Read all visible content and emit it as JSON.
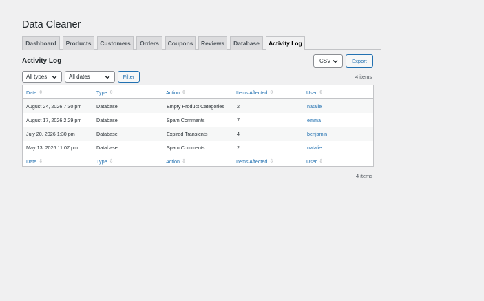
{
  "page": {
    "title": "Data Cleaner"
  },
  "tabs": [
    {
      "label": "Dashboard",
      "active": false
    },
    {
      "label": "Products",
      "active": false
    },
    {
      "label": "Customers",
      "active": false
    },
    {
      "label": "Orders",
      "active": false
    },
    {
      "label": "Coupons",
      "active": false
    },
    {
      "label": "Reviews",
      "active": false
    },
    {
      "label": "Database",
      "active": false
    },
    {
      "label": "Activity Log",
      "active": true
    }
  ],
  "section": {
    "title": "Activity Log"
  },
  "toolbar": {
    "format_select": "CSV",
    "export_label": "Export",
    "type_filter": "All types",
    "date_filter": "All dates",
    "filter_label": "Filter",
    "items_count": "4 items"
  },
  "table": {
    "columns": [
      "Date",
      "Type",
      "Action",
      "Items Affected",
      "User"
    ],
    "sort_icon": "⇳",
    "rows": [
      {
        "date": "August 24, 2026 7:30 pm",
        "type": "Database",
        "action": "Empty Product Categories",
        "items": "2",
        "user": "natalie"
      },
      {
        "date": "August 17, 2026 2:29 pm",
        "type": "Database",
        "action": "Spam Comments",
        "items": "7",
        "user": "emma"
      },
      {
        "date": "July 20, 2026 1:30 pm",
        "type": "Database",
        "action": "Expired Transients",
        "items": "4",
        "user": "benjamin"
      },
      {
        "date": "May 13, 2026 11:07 pm",
        "type": "Database",
        "action": "Spam Comments",
        "items": "2",
        "user": "natalie"
      }
    ]
  },
  "footer": {
    "items_count": "4 items"
  },
  "icons": {
    "chevron": "chevron-down-icon",
    "sort": "sort-arrows-icon"
  },
  "colors": {
    "accent": "#2271b1",
    "background": "#f0f0f1",
    "border": "#c3c4c7"
  }
}
